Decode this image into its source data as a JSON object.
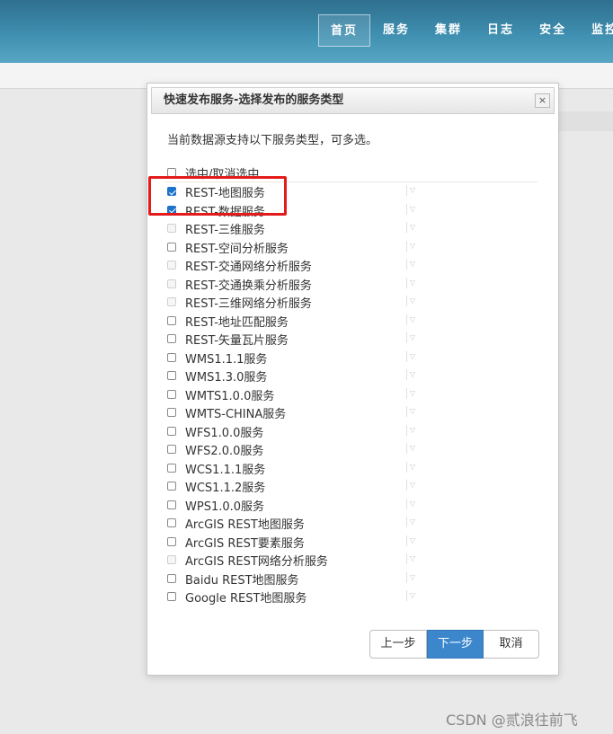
{
  "nav": {
    "items": [
      {
        "label": "首页",
        "active": true
      },
      {
        "label": "服务",
        "active": false
      },
      {
        "label": "集群",
        "active": false
      },
      {
        "label": "日志",
        "active": false
      },
      {
        "label": "安全",
        "active": false
      },
      {
        "label": "监控",
        "active": false
      }
    ]
  },
  "dialog": {
    "title": "快速发布服务-选择发布的服务类型",
    "close": "×",
    "description": "当前数据源支持以下服务类型，可多选。",
    "select_all_label": "选中/取消选中",
    "services": [
      {
        "label": "REST-地图服务",
        "checked": true,
        "enabled": true
      },
      {
        "label": "REST-数据服务",
        "checked": true,
        "enabled": true
      },
      {
        "label": "REST-三维服务",
        "checked": false,
        "enabled": false
      },
      {
        "label": "REST-空间分析服务",
        "checked": false,
        "enabled": true
      },
      {
        "label": "REST-交通网络分析服务",
        "checked": false,
        "enabled": false
      },
      {
        "label": "REST-交通换乘分析服务",
        "checked": false,
        "enabled": false
      },
      {
        "label": "REST-三维网络分析服务",
        "checked": false,
        "enabled": false
      },
      {
        "label": "REST-地址匹配服务",
        "checked": false,
        "enabled": true
      },
      {
        "label": "REST-矢量瓦片服务",
        "checked": false,
        "enabled": true
      },
      {
        "label": "WMS1.1.1服务",
        "checked": false,
        "enabled": true
      },
      {
        "label": "WMS1.3.0服务",
        "checked": false,
        "enabled": true
      },
      {
        "label": "WMTS1.0.0服务",
        "checked": false,
        "enabled": true
      },
      {
        "label": "WMTS-CHINA服务",
        "checked": false,
        "enabled": true
      },
      {
        "label": "WFS1.0.0服务",
        "checked": false,
        "enabled": true
      },
      {
        "label": "WFS2.0.0服务",
        "checked": false,
        "enabled": true
      },
      {
        "label": "WCS1.1.1服务",
        "checked": false,
        "enabled": true
      },
      {
        "label": "WCS1.1.2服务",
        "checked": false,
        "enabled": true
      },
      {
        "label": "WPS1.0.0服务",
        "checked": false,
        "enabled": true
      },
      {
        "label": "ArcGIS REST地图服务",
        "checked": false,
        "enabled": true
      },
      {
        "label": "ArcGIS REST要素服务",
        "checked": false,
        "enabled": true
      },
      {
        "label": "ArcGIS REST网络分析服务",
        "checked": false,
        "enabled": false
      },
      {
        "label": "Baidu REST地图服务",
        "checked": false,
        "enabled": true
      },
      {
        "label": "Google REST地图服务",
        "checked": false,
        "enabled": true
      }
    ],
    "buttons": {
      "prev": "上一步",
      "next": "下一步",
      "cancel": "取消"
    }
  },
  "watermark": "CSDN @贰浪往前飞",
  "colors": {
    "accent": "#3c87cc",
    "highlight": "#e41b1b",
    "header": "#3f8fb0"
  }
}
